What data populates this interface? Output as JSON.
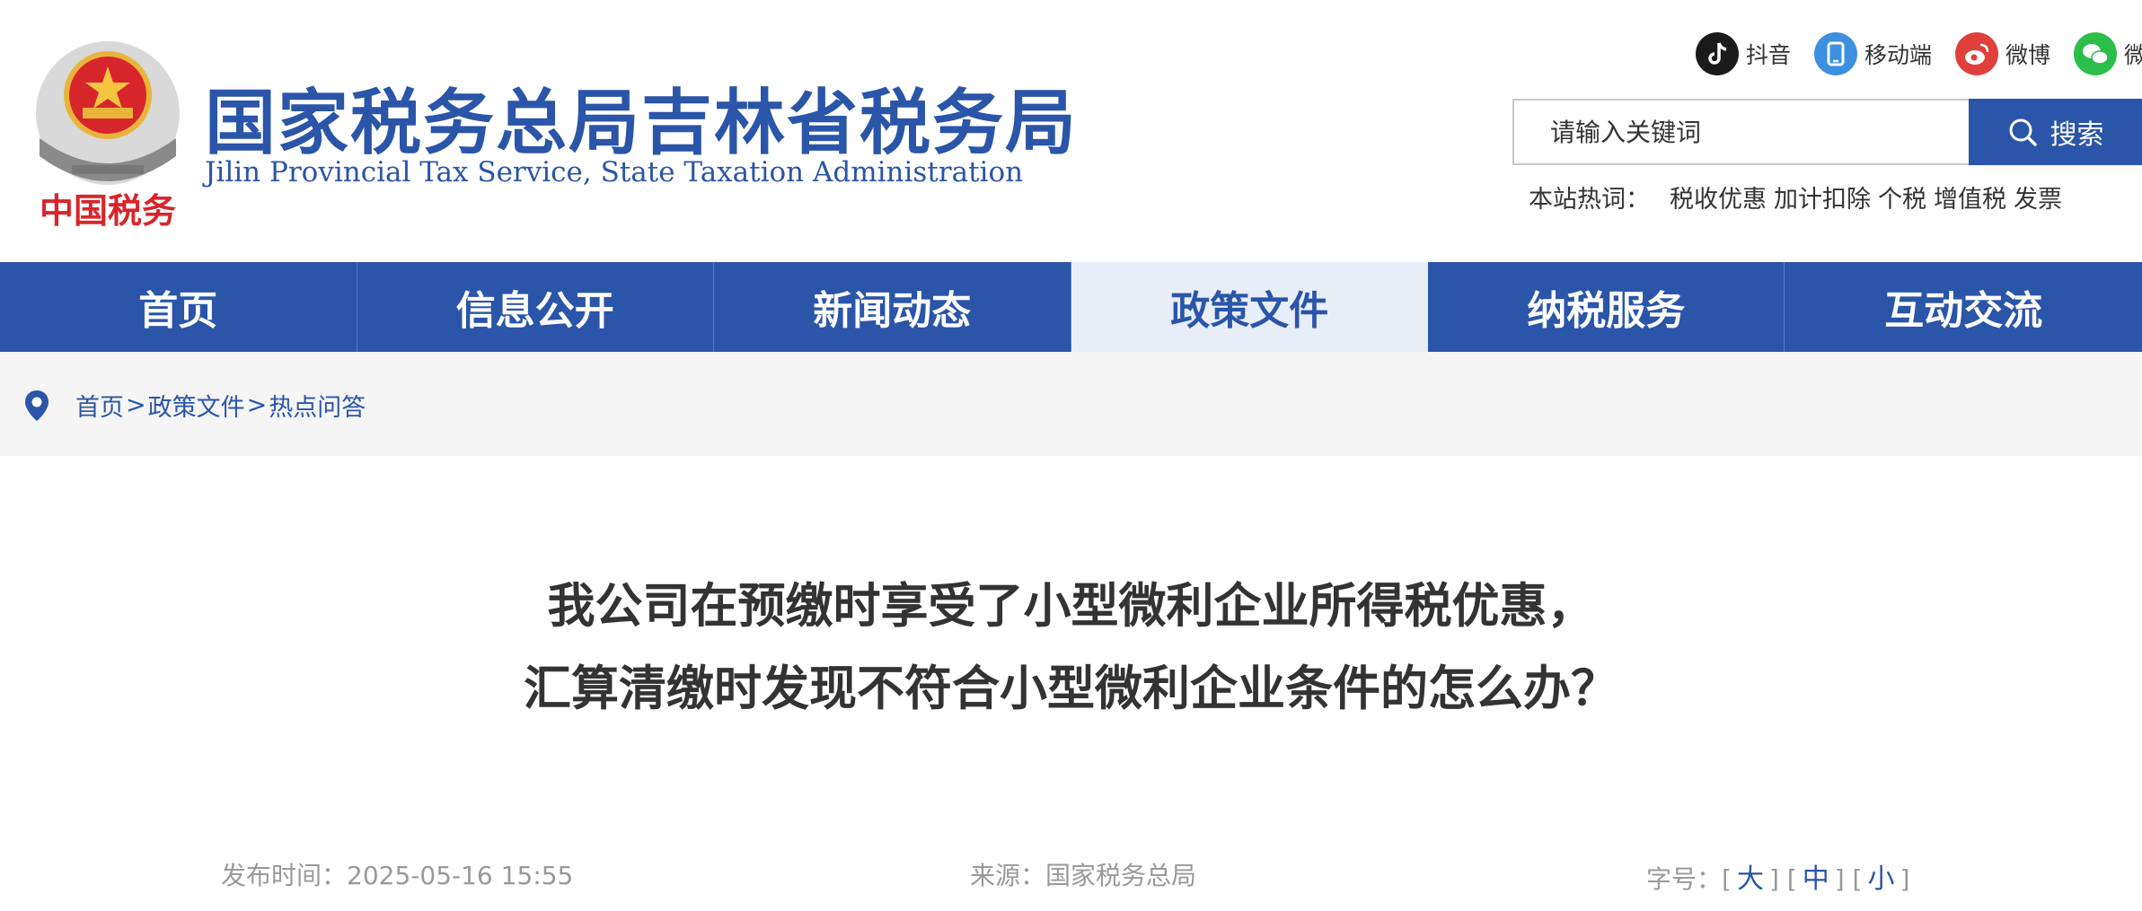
{
  "header": {
    "title": "国家税务总局吉林省税务局",
    "subtitle": "Jilin Provincial Tax Service, State Taxation Administration",
    "emblem_text": "中国税务",
    "social": [
      {
        "label": "抖音",
        "icon": "douyin-icon",
        "color": "#1a1a1a"
      },
      {
        "label": "移动端",
        "icon": "mobile-icon",
        "color": "#3d8fe0"
      },
      {
        "label": "微博",
        "icon": "weibo-icon",
        "color": "#e0403c"
      },
      {
        "label": "微信",
        "icon": "wechat-icon",
        "color": "#2bbe4a"
      }
    ],
    "search": {
      "placeholder": "请输入关键词",
      "button_label": "搜索"
    },
    "hot": {
      "label": "本站热词：",
      "words": [
        "税收优惠",
        "加计扣除",
        "个税",
        "增值税",
        "发票"
      ]
    }
  },
  "nav": {
    "items": [
      "首页",
      "信息公开",
      "新闻动态",
      "政策文件",
      "纳税服务",
      "互动交流"
    ],
    "active": "政策文件"
  },
  "breadcrumb": {
    "items": [
      "首页",
      "政策文件",
      "热点问答"
    ],
    "separator": ">"
  },
  "article": {
    "title_line1": "我公司在预缴时享受了小型微利企业所得税优惠，",
    "title_line2": "汇算清缴时发现不符合小型微利企业条件的怎么办？",
    "publish_label": "发布时间：",
    "publish_time": "2025-05-16 15:55",
    "source_label": "来源：",
    "source": "国家税务总局",
    "font_size_label": "字号：",
    "font_sizes": [
      "大",
      "中",
      "小"
    ]
  },
  "colors": {
    "brand": "#2a55a8",
    "nav_active_bg": "#e8eef8",
    "crumb_bg": "#f5f5f5"
  }
}
